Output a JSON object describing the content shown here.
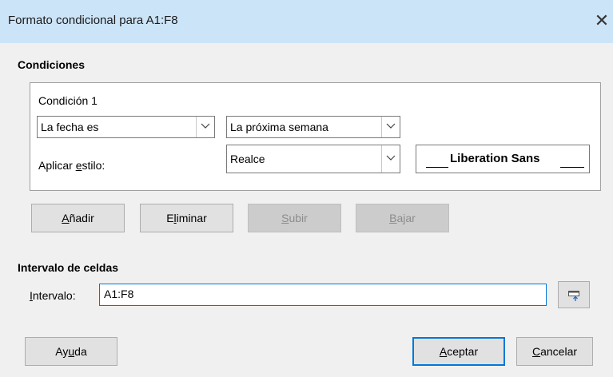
{
  "window": {
    "title": "Formato condicional para A1:F8",
    "close_glyph": "✕"
  },
  "conditions": {
    "section_label": "Condiciones",
    "condition1": {
      "label": "Condición 1",
      "type_value": "La fecha es",
      "date_value": "La próxima semana",
      "apply_style_pre": "Aplicar ",
      "apply_style_accel": "e",
      "apply_style_post": "stilo:",
      "style_value": "Realce",
      "preview_text": "Liberation Sans"
    }
  },
  "buttons": {
    "add": {
      "accel": "A",
      "rest": "ñadir"
    },
    "remove": {
      "pre": "E",
      "accel": "l",
      "rest": "iminar"
    },
    "up": {
      "accel": "S",
      "rest": "ubir"
    },
    "down": {
      "accel": "B",
      "rest": "ajar"
    },
    "help": {
      "pre": "Ay",
      "accel": "u",
      "rest": "da"
    },
    "ok": {
      "accel": "A",
      "rest": "ceptar"
    },
    "cancel": {
      "accel": "C",
      "rest": "ancelar"
    }
  },
  "range": {
    "section_label": "Intervalo de celdas",
    "label_accel": "I",
    "label_rest": "ntervalo:",
    "value": "A1:F8"
  },
  "colors": {
    "titlebar": "#cce4f7",
    "dialog_bg": "#f0f0f0",
    "focus_border": "#0078d7"
  },
  "icons": [
    "close-icon",
    "chevron-down-icon",
    "shrink-dialog-icon"
  ]
}
